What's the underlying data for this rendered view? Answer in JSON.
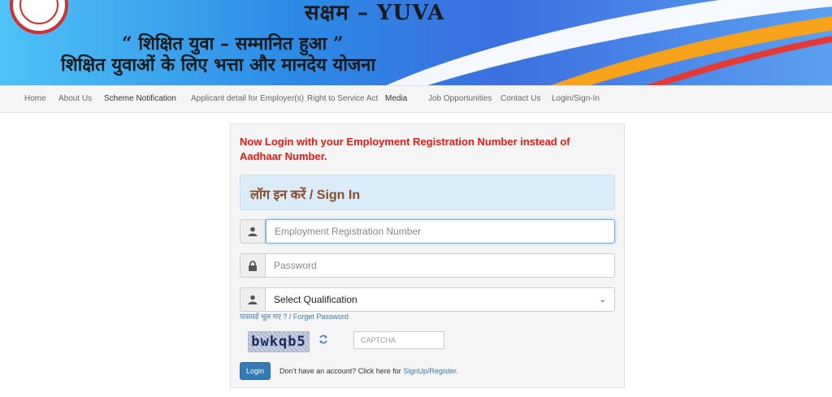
{
  "banner": {
    "title": "सक्षम – YUVA",
    "slogan": "“ शिक्षित युवा – सम्मानित हुआ ”",
    "tagline": "शिक्षित युवाओं के लिए भत्ता और मानदेय योजना"
  },
  "nav": {
    "items": [
      {
        "label": "Home"
      },
      {
        "label": "About Us"
      },
      {
        "label": "Scheme Notification"
      },
      {
        "label": "Applicant detail for Employer(s)"
      },
      {
        "label": "Right to Service Act"
      },
      {
        "label": "Media"
      },
      {
        "label": "Job Opportunities"
      },
      {
        "label": "Contact Us"
      },
      {
        "label": "Login/Sign-In"
      }
    ]
  },
  "login": {
    "notice": "Now Login with your Employment Registration Number instead of Aadhaar Number.",
    "heading": "लॉग इन करें / Sign In",
    "registration_placeholder": "Employment Registration Number",
    "password_placeholder": "Password",
    "qualification_selected": "Select Qualification",
    "forgot_password": "पासवर्ड भूल गए ? / Forget Password",
    "captcha_text": "bwkqb5",
    "captcha_placeholder": "CAPTCHA",
    "login_button": "Login",
    "signup_prompt": "Don't have an account? Click here for ",
    "signup_link": "SignUp/Register."
  },
  "colors": {
    "notice": "#e8190f",
    "heading": "#8a4a2b",
    "primary": "#337ab7",
    "signin_box": "#d9ecf7"
  },
  "icons": {
    "user": "user-icon",
    "lock": "lock-icon",
    "refresh": "refresh-icon"
  }
}
